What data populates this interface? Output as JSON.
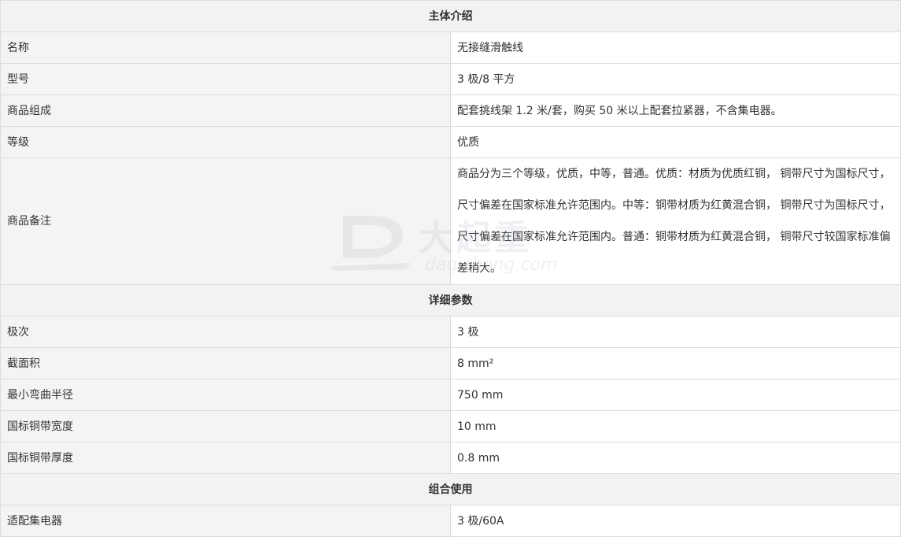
{
  "sections": {
    "intro_title": "主体介绍",
    "params_title": "详细参数",
    "combo_title": "组合使用"
  },
  "intro": [
    {
      "label": "名称",
      "value": "无接缝滑触线"
    },
    {
      "label": "型号",
      "value": "3 极/8 平方"
    },
    {
      "label": "商品组成",
      "value": "配套挑线架 1.2 米/套，购买 50 米以上配套拉紧器，不含集电器。"
    },
    {
      "label": "等级",
      "value": "优质"
    },
    {
      "label": "商品备注",
      "value": "商品分为三个等级，优质，中等，普通。优质：材质为优质红铜， 铜带尺寸为国标尺寸，尺寸偏差在国家标准允许范围内。中等：铜带材质为红黄混合铜， 铜带尺寸为国标尺寸，尺寸偏差在国家标准允许范围内。普通：铜带材质为红黄混合铜， 铜带尺寸较国家标准偏差稍大。"
    }
  ],
  "params": [
    {
      "label": "极次",
      "value": "3 极"
    },
    {
      "label": "截面积",
      "value": "8 mm²"
    },
    {
      "label": "最小弯曲半径",
      "value": "750 mm"
    },
    {
      "label": "国标铜带宽度",
      "value": "10 mm"
    },
    {
      "label": "国标铜带厚度",
      "value": "0.8 mm"
    }
  ],
  "combo": [
    {
      "label": "适配集电器",
      "value": "3 极/60A"
    }
  ],
  "watermark": {
    "cn": "大起重",
    "en": "daqizhong.com",
    "logo_icon": "crane-hook-logo-icon"
  }
}
